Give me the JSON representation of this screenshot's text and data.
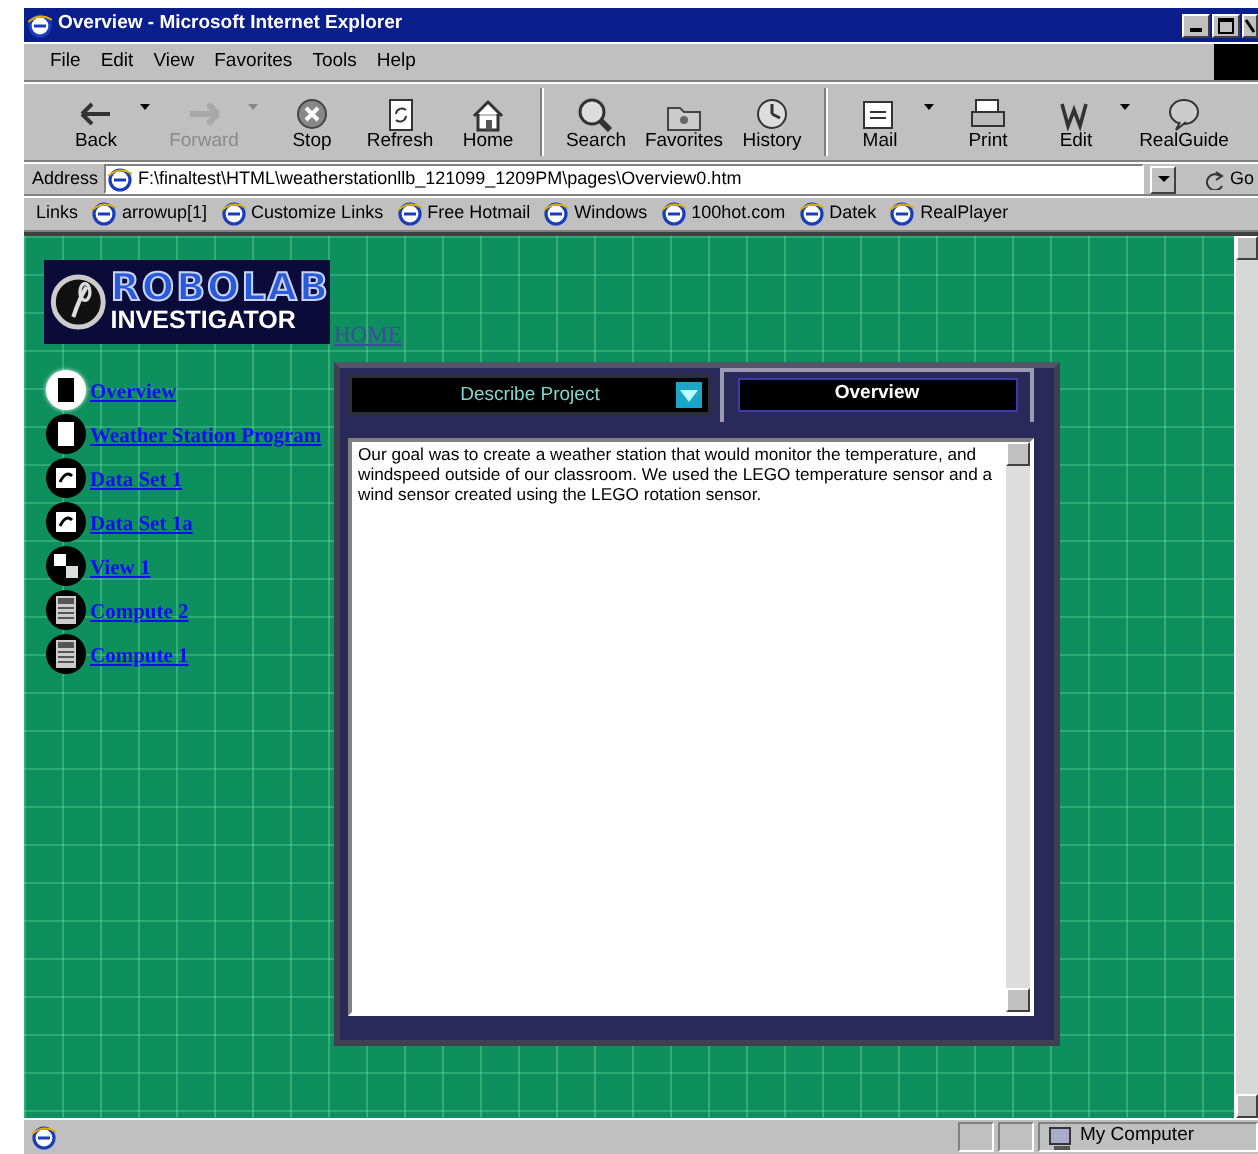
{
  "window": {
    "title": "Overview - Microsoft Internet Explorer"
  },
  "menu": [
    "File",
    "Edit",
    "View",
    "Favorites",
    "Tools",
    "Help"
  ],
  "toolbar": [
    [
      {
        "label": "Back",
        "kind": "back",
        "disabled": false,
        "dropdown": true
      },
      {
        "label": "Forward",
        "kind": "forward",
        "disabled": true,
        "dropdown": true
      },
      {
        "label": "Stop",
        "kind": "stop",
        "disabled": false,
        "dropdown": false
      },
      {
        "label": "Refresh",
        "kind": "refresh",
        "disabled": false,
        "dropdown": false
      },
      {
        "label": "Home",
        "kind": "home",
        "disabled": false,
        "dropdown": false
      }
    ],
    [
      {
        "label": "Search",
        "kind": "search",
        "disabled": false,
        "dropdown": false
      },
      {
        "label": "Favorites",
        "kind": "folder",
        "disabled": false,
        "dropdown": false
      },
      {
        "label": "History",
        "kind": "history",
        "disabled": false,
        "dropdown": false
      }
    ],
    [
      {
        "label": "Mail",
        "kind": "mail",
        "disabled": false,
        "dropdown": true
      },
      {
        "label": "Print",
        "kind": "print",
        "disabled": false,
        "dropdown": false
      },
      {
        "label": "Edit",
        "kind": "edit",
        "disabled": false,
        "dropdown": true
      },
      {
        "label": "RealGuide",
        "kind": "guide",
        "disabled": false,
        "dropdown": false
      }
    ]
  ],
  "address": {
    "label": "Address",
    "value": "F:\\finaltest\\HTML\\weatherstationllb_121099_1209PM\\pages\\Overview0.htm",
    "go": "Go"
  },
  "links": {
    "label": "Links",
    "items": [
      "arrowup[1]",
      "Customize Links",
      "Free Hotmail",
      "Windows",
      "100hot.com",
      "Datek",
      "RealPlayer"
    ]
  },
  "page": {
    "logo": {
      "title": "ROBOLAB",
      "subtitle": "INVESTIGATOR"
    },
    "home_link": "HOME",
    "nav": [
      {
        "label": "Overview",
        "kind": "book",
        "selected": true
      },
      {
        "label": "Weather Station Program",
        "kind": "book",
        "selected": false
      },
      {
        "label": "Data Set 1",
        "kind": "data",
        "selected": false
      },
      {
        "label": "Data Set 1a",
        "kind": "data",
        "selected": false
      },
      {
        "label": "View 1",
        "kind": "view",
        "selected": false
      },
      {
        "label": "Compute 2",
        "kind": "calculator",
        "selected": false
      },
      {
        "label": "Compute 1",
        "kind": "calculator",
        "selected": false
      }
    ],
    "panel": {
      "dropdown": "Describe Project",
      "tab": "Overview",
      "text": "Our goal was to create a weather station that would monitor the temperature, and windspeed outside of our classroom.  We used the LEGO temperature sensor and a wind sensor created using the LEGO rotation sensor."
    }
  },
  "status_bar": {
    "zone": "My Computer"
  }
}
